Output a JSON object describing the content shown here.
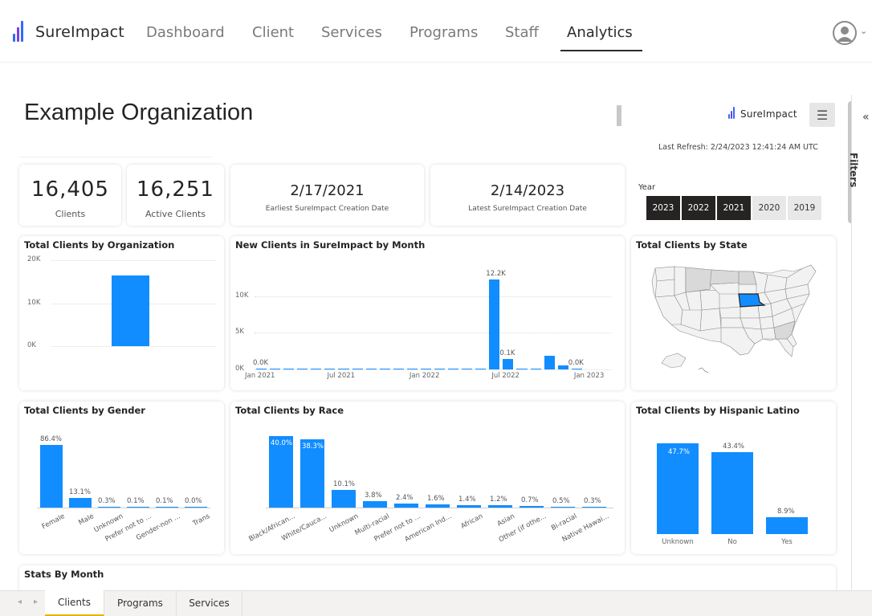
{
  "nav": {
    "brand": "SureImpact",
    "items": [
      "Dashboard",
      "Client",
      "Services",
      "Programs",
      "Staff",
      "Analytics"
    ],
    "active": "Analytics"
  },
  "report": {
    "org_title": "Example Organization",
    "brand_small": "SureImpact",
    "last_refresh": "Last Refresh: 2/24/2023 12:41:24 AM UTC"
  },
  "kpis": {
    "clients": {
      "value": "16,405",
      "label": "Clients"
    },
    "active_clients": {
      "value": "16,251",
      "label": "Active Clients"
    },
    "earliest": {
      "value": "2/17/2021",
      "label": "Earliest SureImpact Creation Date"
    },
    "latest": {
      "value": "2/14/2023",
      "label": "Latest SureImpact Creation Date"
    }
  },
  "year_filter": {
    "label": "Year",
    "options": [
      {
        "label": "2023",
        "selected": true
      },
      {
        "label": "2022",
        "selected": true
      },
      {
        "label": "2021",
        "selected": true
      },
      {
        "label": "2020",
        "selected": false
      },
      {
        "label": "2019",
        "selected": false
      }
    ]
  },
  "filters_pane": {
    "label": "Filters"
  },
  "colors": {
    "bar": "#118dff",
    "selected_year": "#252423",
    "state_highlight": "#118dff"
  },
  "chart_data": [
    {
      "id": "org",
      "type": "bar",
      "title": "Total Clients by Organization",
      "categories": [
        ""
      ],
      "values": [
        16405
      ],
      "ylim": [
        0,
        20000
      ],
      "yticks": [
        "0K",
        "10K",
        "20K"
      ],
      "grid": true
    },
    {
      "id": "month",
      "type": "bar",
      "title": "New Clients in SureImpact by Month",
      "x": [
        "2021-01",
        "2021-02",
        "2021-03",
        "2021-04",
        "2021-05",
        "2021-06",
        "2021-07",
        "2021-08",
        "2021-09",
        "2021-10",
        "2021-11",
        "2021-12",
        "2022-01",
        "2022-02",
        "2022-03",
        "2022-04",
        "2022-05",
        "2022-06",
        "2022-07",
        "2022-08",
        "2022-09",
        "2022-10",
        "2022-11",
        "2022-12",
        "2023-01",
        "2023-02"
      ],
      "values": [
        20,
        0,
        60,
        50,
        40,
        0,
        0,
        0,
        0,
        40,
        40,
        40,
        0,
        0,
        0,
        40,
        40,
        12200,
        1400,
        60,
        50,
        1900,
        500,
        20
      ],
      "data_labels": [
        {
          "index": 0,
          "text": "0.0K"
        },
        {
          "index": 17,
          "text": "12.2K"
        },
        {
          "index": 18,
          "text": "0.1K"
        },
        {
          "index": 23,
          "text": "0.0K"
        }
      ],
      "xticks": [
        "Jan 2021",
        "Jul 2021",
        "Jan 2022",
        "Jul 2022",
        "Jan 2023"
      ],
      "yticks": [
        "0K",
        "5K",
        "10K"
      ],
      "ylim": [
        0,
        14000
      ],
      "grid": true
    },
    {
      "id": "state",
      "type": "map",
      "title": "Total Clients by State",
      "highlighted": [
        "Nebraska"
      ]
    },
    {
      "id": "gender",
      "type": "bar",
      "title": "Total Clients by Gender",
      "categories": [
        "Female",
        "Male",
        "Unknown",
        "Prefer not to ...",
        "Gender-non ...",
        "Trans"
      ],
      "values": [
        86.4,
        13.1,
        0.3,
        0.1,
        0.1,
        0.0
      ],
      "data_labels": [
        "86.4%",
        "13.1%",
        "0.3%",
        "0.1%",
        "0.1%",
        "0.0%"
      ],
      "ylim": [
        0,
        100
      ]
    },
    {
      "id": "race",
      "type": "bar",
      "title": "Total Clients by Race",
      "categories": [
        "Black/African...",
        "White/Cauca...",
        "Unknown",
        "Multi-racial",
        "Prefer not to ...",
        "American Ind...",
        "African",
        "Asian",
        "Other (if othe...",
        "Bi-racial",
        "Native Hawai..."
      ],
      "values": [
        40.0,
        38.3,
        10.1,
        3.8,
        2.4,
        1.6,
        1.4,
        1.2,
        0.7,
        0.5,
        0.3
      ],
      "data_labels": [
        "40.0%",
        "38.3%",
        "10.1%",
        "3.8%",
        "2.4%",
        "1.6%",
        "1.4%",
        "1.2%",
        "0.7%",
        "0.5%",
        "0.3%"
      ],
      "ylim": [
        0,
        45
      ]
    },
    {
      "id": "hispanic",
      "type": "bar",
      "title": "Total Clients by Hispanic Latino",
      "categories": [
        "Unknown",
        "No",
        "Yes"
      ],
      "values": [
        47.7,
        43.4,
        8.9
      ],
      "data_labels": [
        "47.7%",
        "43.4%",
        "8.9%"
      ],
      "ylim": [
        0,
        50
      ]
    },
    {
      "id": "stats_month",
      "type": "table",
      "title": "Stats By Month"
    }
  ],
  "tabs": [
    {
      "label": "Clients",
      "active": true
    },
    {
      "label": "Programs",
      "active": false
    },
    {
      "label": "Services",
      "active": false
    }
  ]
}
